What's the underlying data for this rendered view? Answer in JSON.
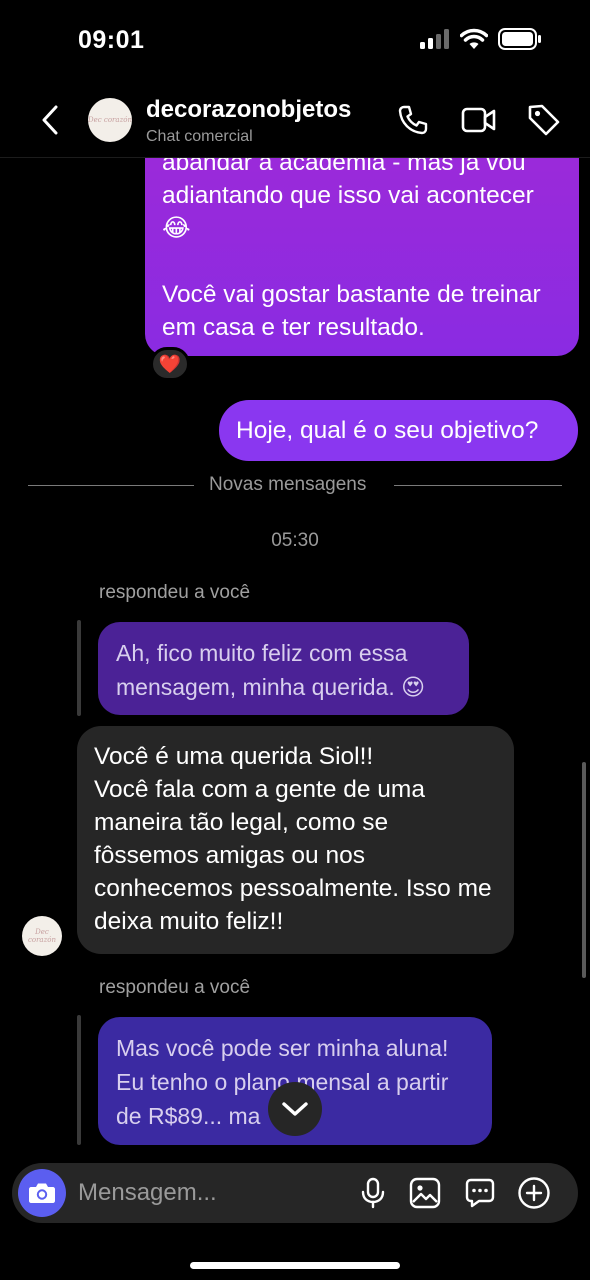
{
  "status_bar": {
    "time": "09:01"
  },
  "header": {
    "contact_name": "decorazonobjetos",
    "contact_subtitle": "Chat comercial",
    "avatar_text": "Dec corazón"
  },
  "messages": {
    "outgoing_1": "abandar a academia - mas já vou adiantando que isso vai acontecer 😂\n\nVocê vai gostar bastante de treinar em casa e ter resultado.",
    "outgoing_1_reaction": "❤️",
    "outgoing_2": "Hoje, qual é o seu objetivo?",
    "new_messages_divider": "Novas mensagens",
    "timestamp": "05:30",
    "reply_label_1": "respondeu a você",
    "quoted_1": "Ah, fico muito feliz com essa mensagem, minha querida. 😍",
    "incoming_1": "Você é uma querida Siol!!\nVocê fala com a gente de uma maneira tão legal, como se fôssemos amigas ou nos conhecemos pessoalmente.  Isso me deixa muito feliz!!",
    "reply_label_2": "respondeu a você",
    "quoted_2": "Mas você pode ser minha aluna!\nEu tenho o plano mensal a partir de R$89... ma"
  },
  "composer": {
    "placeholder": "Mensagem..."
  },
  "colors": {
    "outgoing_gradient_top": "#9d2ad8",
    "outgoing_solid": "#8a37f0",
    "quoted_1_bg": "#4b2296",
    "quoted_2_bg": "#3b2aa2",
    "incoming_bg": "#262626",
    "camera_button": "#5b5ef0"
  },
  "icons": {
    "back": "chevron-left-icon",
    "call": "phone-icon",
    "video": "video-camera-icon",
    "tag": "tag-icon",
    "camera": "camera-icon",
    "mic": "microphone-icon",
    "gallery": "image-icon",
    "sticker": "chat-sticker-icon",
    "add": "plus-circle-icon",
    "scroll_down": "chevron-down-icon"
  }
}
